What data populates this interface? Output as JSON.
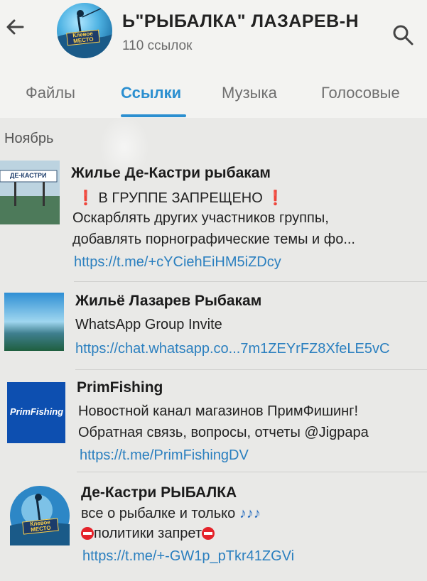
{
  "header": {
    "title": "Ь\"РЫБАЛКА\"  ЛАЗАРЕВ-Н",
    "subtitle": "110 ссылок",
    "avatar_label": "Клевое МЕСТО"
  },
  "tabs": [
    {
      "label": "Файлы"
    },
    {
      "label": "Ссылки"
    },
    {
      "label": "Музыка"
    },
    {
      "label": "Голосовые"
    }
  ],
  "active_tab": "Ссылки",
  "section_label": "Ноябрь",
  "links": [
    {
      "name": "Жилье Де-Кастри рыбакам",
      "line1": "В ГРУППЕ ЗАПРЕЩЕНО",
      "line2": "Оскарблять других участников группы,",
      "line3": "добавлять порнографические темы и фо...",
      "url": "https://t.me/+cYCiehEiHM5iZDcy",
      "thumb_label": "ДЕ-КАСТРИ"
    },
    {
      "name": "Жильё Лазарев Рыбакам",
      "line1": "WhatsApp Group Invite",
      "url": "https://chat.whatsapp.co...7m1ZEYrFZ8XfeLE5vC"
    },
    {
      "name": "PrimFishing",
      "line1": "Новостной канал магазинов ПримФишинг!",
      "line2": "Обратная связь, вопросы, отчеты @Jigpapa",
      "url": "https://t.me/PrimFishingDV",
      "thumb_label": "PrimFishing"
    },
    {
      "name": "Де-Кастри РЫБАЛКА",
      "line1": "все о рыбалке и только",
      "line2": "политики запрет",
      "url": "https://t.me/+-GW1p_pTkr41ZGVi",
      "thumb_label": "Клевое МЕСТО"
    }
  ],
  "colors": {
    "accent": "#2b8fd0",
    "link": "#2a7fbf",
    "warning": "#e4232a"
  }
}
